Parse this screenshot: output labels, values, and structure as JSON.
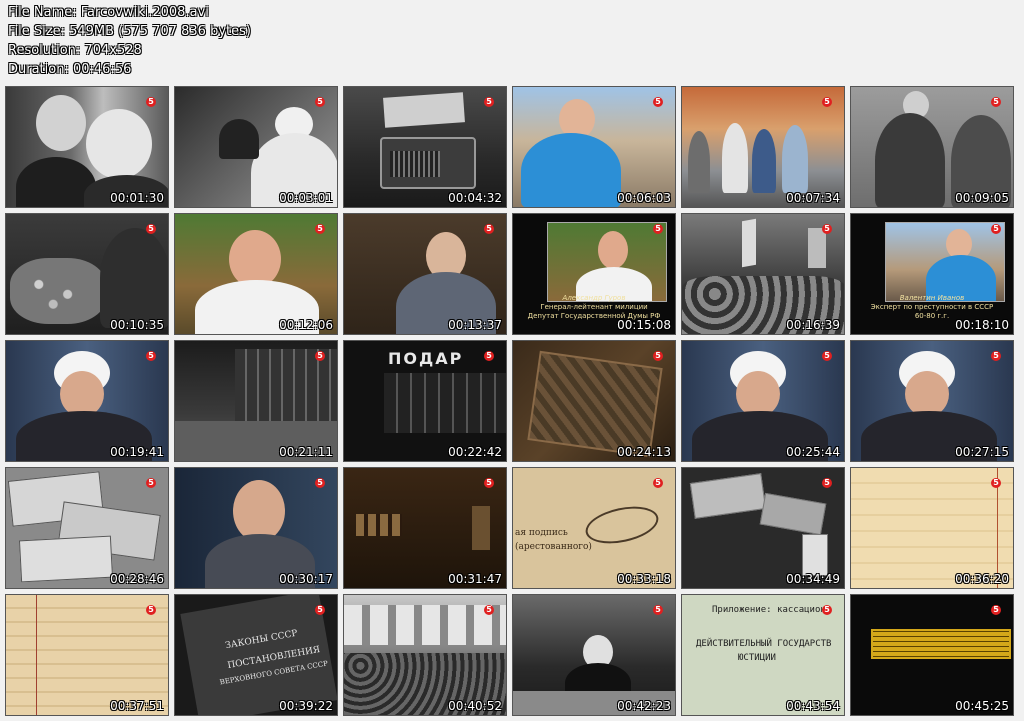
{
  "file_info": {
    "name": "File Name: Farcovwiki.2008.avi",
    "size": "File Size: 549MB (575 707 836 bytes)",
    "resolution": "Resolution: 704x528",
    "duration": "Duration: 00:46:56"
  },
  "channel_logo": "5",
  "thumbnails": [
    {
      "time": "00:01:30"
    },
    {
      "time": "00:03:01"
    },
    {
      "time": "00:04:32"
    },
    {
      "time": "00:06:03"
    },
    {
      "time": "00:07:34"
    },
    {
      "time": "00:09:05"
    },
    {
      "time": "00:10:35"
    },
    {
      "time": "00:12:06"
    },
    {
      "time": "00:13:37"
    },
    {
      "time": "00:15:08",
      "caption_1": "Александр Гуров",
      "caption_2": "Генерал-лейтенант милиции",
      "caption_3": "Депутат Государственной Думы РФ"
    },
    {
      "time": "00:16:39"
    },
    {
      "time": "00:18:10",
      "caption_1": "Валентин Иванов",
      "caption_2": "Эксперт по преступности в СССР",
      "caption_3": "60-80 г.г."
    },
    {
      "time": "00:19:41"
    },
    {
      "time": "00:21:11"
    },
    {
      "time": "00:22:42",
      "sign": "ПОДАР"
    },
    {
      "time": "00:24:13"
    },
    {
      "time": "00:25:44"
    },
    {
      "time": "00:27:15"
    },
    {
      "time": "00:28:46"
    },
    {
      "time": "00:30:17"
    },
    {
      "time": "00:31:47"
    },
    {
      "time": "00:33:18",
      "doc_1": "ая подпись",
      "doc_2": "(арестованного)"
    },
    {
      "time": "00:34:49"
    },
    {
      "time": "00:36:20"
    },
    {
      "time": "00:37:51"
    },
    {
      "time": "00:39:22",
      "doc_1": "ЗАКОНЫ СССР",
      "doc_2": "ПОСТАНОВЛЕНИЯ",
      "doc_3": "ВЕРХОВНОГО СОВЕТА СССР"
    },
    {
      "time": "00:40:52"
    },
    {
      "time": "00:42:23"
    },
    {
      "time": "00:43:54",
      "doc_1": "Приложение: кассацион",
      "doc_2": "ДЕЙСТВИТЕЛЬНЫЙ ГОСУДАРСТВ",
      "doc_3": "ЮСТИЦИИ"
    },
    {
      "time": "00:45:25"
    }
  ]
}
